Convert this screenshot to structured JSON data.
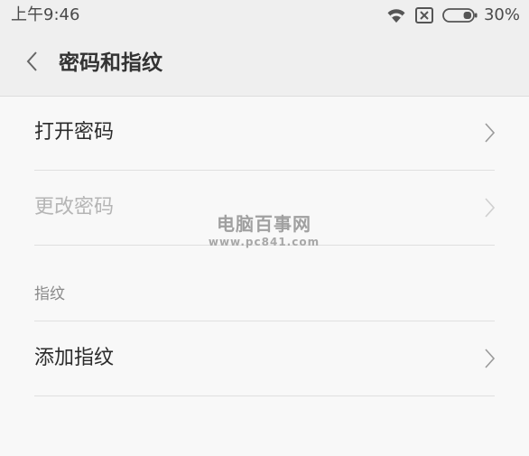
{
  "status_bar": {
    "time": "上午9:46",
    "battery_percent": "30%",
    "battery_level": 0.3,
    "icons": [
      "wifi-icon",
      "no-sim-icon",
      "battery-icon"
    ]
  },
  "header": {
    "back_icon": "chevron-left-icon",
    "title": "密码和指纹"
  },
  "items": [
    {
      "label": "打开密码",
      "enabled": true,
      "icon": "chevron-right-icon"
    },
    {
      "label": "更改密码",
      "enabled": false,
      "icon": "chevron-right-icon"
    }
  ],
  "fingerprint_section": {
    "header": "指纹",
    "items": [
      {
        "label": "添加指纹",
        "enabled": true,
        "icon": "chevron-right-icon"
      }
    ]
  },
  "watermark": {
    "title": "电脑百事网",
    "url": "www.pc841.com"
  },
  "colors": {
    "background": "#f8f8f8",
    "header_background": "#efefef",
    "text_primary": "#2b2b2b",
    "text_disabled": "#b5b5b5",
    "divider": "#e0e0e0"
  }
}
